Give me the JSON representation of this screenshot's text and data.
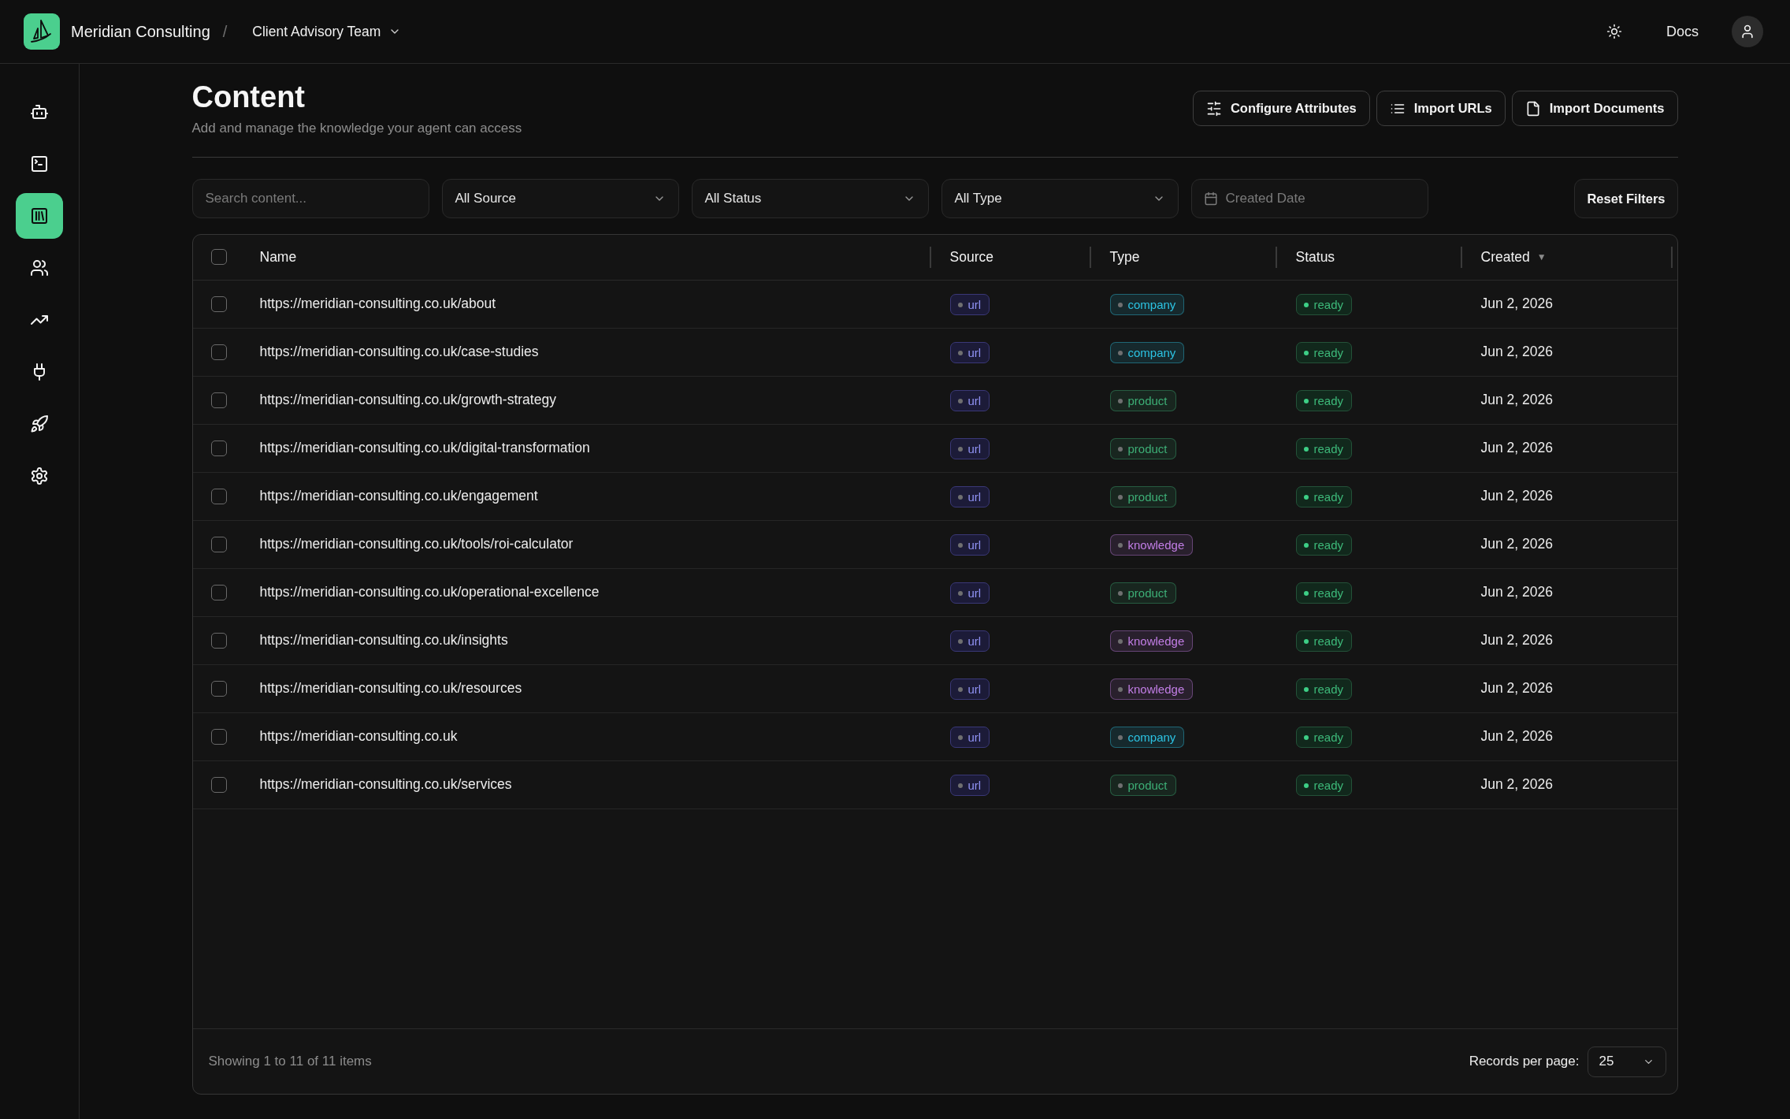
{
  "topbar": {
    "brand": "Meridian Consulting",
    "separator": "/",
    "team": "Client Advisory Team",
    "docs": "Docs"
  },
  "sidebar": {
    "items": [
      {
        "selected": false
      },
      {
        "selected": false
      },
      {
        "selected": true
      },
      {
        "selected": false
      },
      {
        "selected": false
      },
      {
        "selected": false
      },
      {
        "selected": false
      },
      {
        "selected": false
      }
    ]
  },
  "page": {
    "title": "Content",
    "subtitle": "Add and manage the knowledge your agent can access",
    "actions": [
      "Configure Attributes",
      "Import URLs",
      "Import Documents"
    ]
  },
  "filters": {
    "search": {
      "placeholder": "Search content..."
    },
    "selects": [
      "All Source",
      "All Status",
      "All Type"
    ],
    "date": {
      "placeholder": "Created Date"
    },
    "reset": "Reset Filters"
  },
  "table": {
    "select_all_checked": false,
    "columns": [
      {
        "label": "Name"
      },
      {
        "label": "Source"
      },
      {
        "label": "Type"
      },
      {
        "label": "Status"
      },
      {
        "label": "Created",
        "sort_indicator": "▼"
      }
    ],
    "rows": [
      {
        "name": "https://meridian-consulting.co.uk/about",
        "source": "url",
        "type": {
          "label": "company",
          "color": "#2cc3e3"
        },
        "status": "ready",
        "created": "Jun 2, 2026",
        "checked": false
      },
      {
        "name": "https://meridian-consulting.co.uk/case-studies",
        "source": "url",
        "type": {
          "label": "company",
          "color": "#2cc3e3"
        },
        "status": "ready",
        "created": "Jun 2, 2026",
        "checked": false
      },
      {
        "name": "https://meridian-consulting.co.uk/growth-strategy",
        "source": "url",
        "type": {
          "label": "product",
          "color": "#3dae76"
        },
        "status": "ready",
        "created": "Jun 2, 2026",
        "checked": false
      },
      {
        "name": "https://meridian-consulting.co.uk/digital-transformation",
        "source": "url",
        "type": {
          "label": "product",
          "color": "#3dae76"
        },
        "status": "ready",
        "created": "Jun 2, 2026",
        "checked": false
      },
      {
        "name": "https://meridian-consulting.co.uk/engagement",
        "source": "url",
        "type": {
          "label": "product",
          "color": "#3dae76"
        },
        "status": "ready",
        "created": "Jun 2, 2026",
        "checked": false
      },
      {
        "name": "https://meridian-consulting.co.uk/tools/roi-calculator",
        "source": "url",
        "type": {
          "label": "knowledge",
          "color": "#c27ee6"
        },
        "status": "ready",
        "created": "Jun 2, 2026",
        "checked": false
      },
      {
        "name": "https://meridian-consulting.co.uk/operational-excellence",
        "source": "url",
        "type": {
          "label": "product",
          "color": "#3dae76"
        },
        "status": "ready",
        "created": "Jun 2, 2026",
        "checked": false
      },
      {
        "name": "https://meridian-consulting.co.uk/insights",
        "source": "url",
        "type": {
          "label": "knowledge",
          "color": "#c27ee6"
        },
        "status": "ready",
        "created": "Jun 2, 2026",
        "checked": false
      },
      {
        "name": "https://meridian-consulting.co.uk/resources",
        "source": "url",
        "type": {
          "label": "knowledge",
          "color": "#c27ee6"
        },
        "status": "ready",
        "created": "Jun 2, 2026",
        "checked": false
      },
      {
        "name": "https://meridian-consulting.co.uk",
        "source": "url",
        "type": {
          "label": "company",
          "color": "#2cc3e3"
        },
        "status": "ready",
        "created": "Jun 2, 2026",
        "checked": false
      },
      {
        "name": "https://meridian-consulting.co.uk/services",
        "source": "url",
        "type": {
          "label": "product",
          "color": "#3dae76"
        },
        "status": "ready",
        "created": "Jun 2, 2026",
        "checked": false
      }
    ]
  },
  "footer": {
    "summary": "Showing 1 to 11 of 11 items",
    "per_page_label": "Records per page:",
    "per_page": "25"
  }
}
